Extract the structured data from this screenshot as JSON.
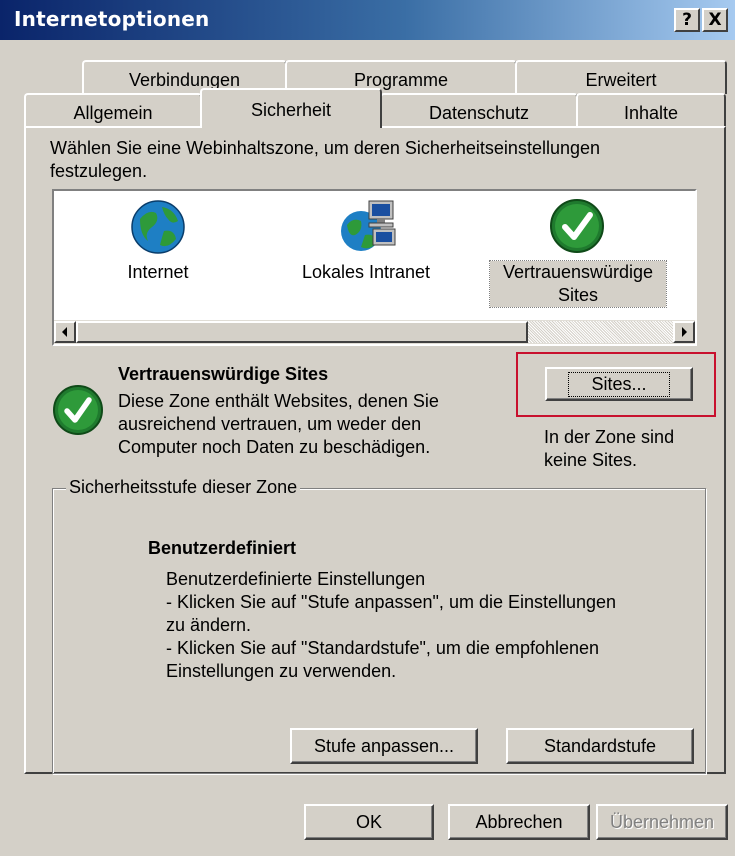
{
  "window": {
    "title": "Internetoptionen",
    "help_button": "?",
    "close_button": "X"
  },
  "tabs": {
    "row1": [
      "Verbindungen",
      "Programme",
      "Erweitert"
    ],
    "row2": [
      "Allgemein",
      "Sicherheit",
      "Datenschutz",
      "Inhalte"
    ],
    "active": "Sicherheit"
  },
  "instruction": {
    "line1": "Wählen Sie eine Webinhaltszone, um deren Sicherheitseinstellungen",
    "line2": "festzulegen."
  },
  "zones": [
    {
      "label": "Internet",
      "icon": "globe-icon"
    },
    {
      "label": "Lokales Intranet",
      "icon": "intranet-icon"
    },
    {
      "label_line1": "Vertrauenswürdige",
      "label_line2": "Sites",
      "icon": "trusted-check-icon",
      "selected": true
    }
  ],
  "zone_info": {
    "title": "Vertrauenswürdige Sites",
    "desc_line1": "Diese Zone enthält Websites, denen Sie",
    "desc_line2": "ausreichend vertrauen, um weder den",
    "desc_line3": "Computer noch Daten zu beschädigen.",
    "sites_button": "Sites...",
    "sites_note_line1": "In der Zone sind",
    "sites_note_line2": "keine Sites."
  },
  "security_level": {
    "group_label": "Sicherheitsstufe dieser Zone",
    "title": "Benutzerdefiniert",
    "line1": "Benutzerdefinierte Einstellungen",
    "line2": "- Klicken Sie auf \"Stufe anpassen\", um die Einstellungen",
    "line3": "zu ändern.",
    "line4": "- Klicken Sie auf \"Standardstufe\", um die empfohlenen",
    "line5": "Einstellungen zu verwenden.",
    "custom_button": "Stufe anpassen...",
    "default_button": "Standardstufe"
  },
  "footer": {
    "ok": "OK",
    "cancel": "Abbrechen",
    "apply": "Übernehmen"
  },
  "colors": {
    "titlebar": "#0a246a",
    "highlight_box": "#c8102e",
    "selection": "#d4d0c8"
  }
}
